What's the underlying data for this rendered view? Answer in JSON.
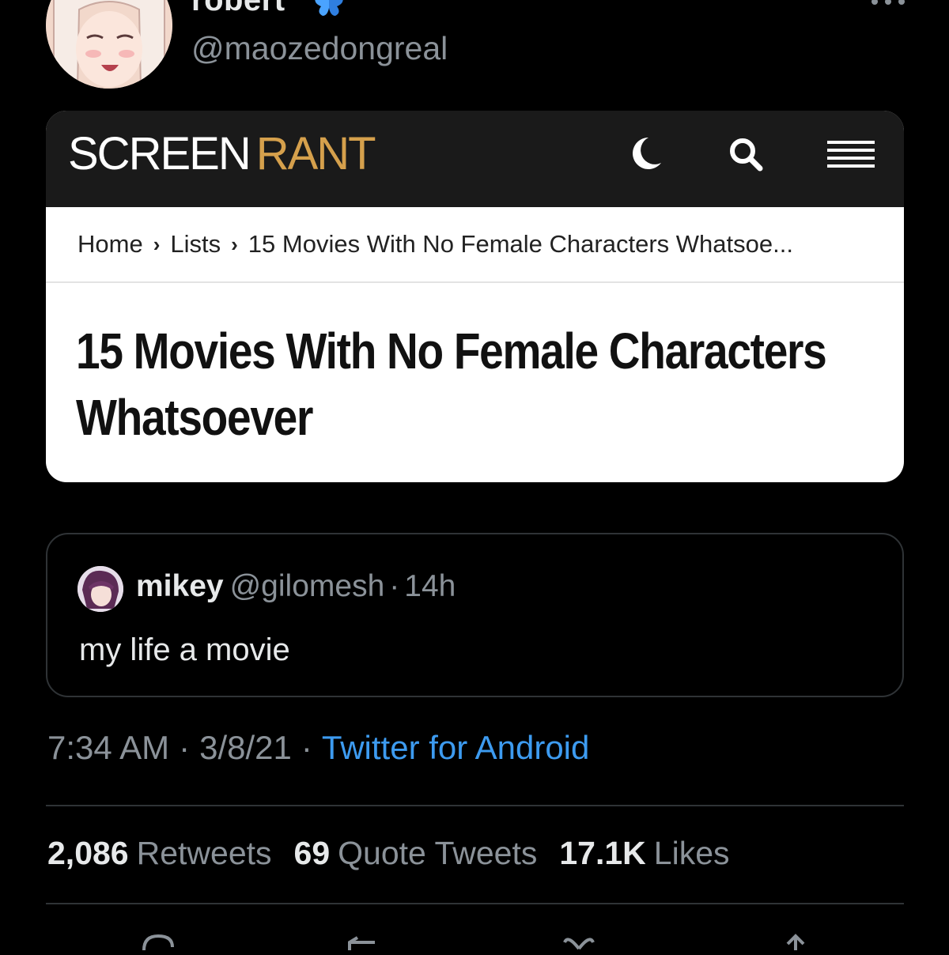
{
  "tweet": {
    "display_name": "robert",
    "handle": "@maozedongreal",
    "timestamp": "7:34 AM",
    "date": "3/8/21",
    "source": "Twitter for Android"
  },
  "card": {
    "logo_left": "SCREEN",
    "logo_right": "RANT",
    "breadcrumb": [
      "Home",
      "Lists",
      "15 Movies With No Female Characters Whatsoe..."
    ],
    "title": "15 Movies With No Female Characters Whatsoever"
  },
  "quote": {
    "name": "mikey",
    "handle": "@gilomesh",
    "time": "14h",
    "text": "my life a movie"
  },
  "stats": {
    "retweets_count": "2,086",
    "retweets_label": "Retweets",
    "quotes_count": "69",
    "quotes_label": "Quote Tweets",
    "likes_count": "17.1K",
    "likes_label": "Likes"
  },
  "icons": {
    "verified_emoji": "butterfly-icon",
    "menu": "more-icon",
    "theme": "moon-icon",
    "search": "search-icon",
    "nav": "hamburger-menu-icon"
  },
  "colors": {
    "background": "#000000",
    "link": "#3d9bf0",
    "brand_accent": "#d5a04c",
    "secondary_text": "#8b9299"
  }
}
